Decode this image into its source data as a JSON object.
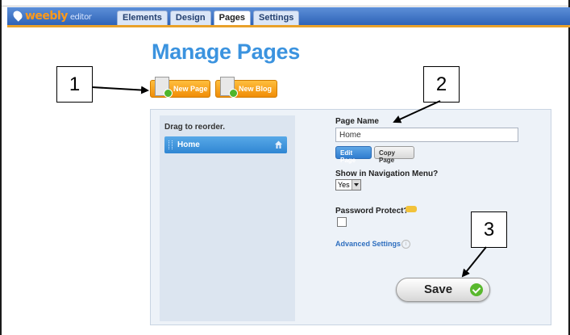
{
  "app": {
    "logo": "weebly",
    "logo_suffix": "editor",
    "tabs": [
      {
        "label": "Elements"
      },
      {
        "label": "Design"
      },
      {
        "label": "Pages",
        "active": true
      },
      {
        "label": "Settings"
      }
    ]
  },
  "page_title": "Manage Pages",
  "toolbar": {
    "new_page_label": "New Page",
    "new_blog_label": "New Blog"
  },
  "pages_list": {
    "instruction": "Drag to reorder.",
    "items": [
      {
        "label": "Home",
        "icon": "home-icon"
      }
    ]
  },
  "form": {
    "page_name_label": "Page Name",
    "page_name_value": "Home",
    "edit_page_label": "Edit Page",
    "copy_page_label": "Copy Page",
    "nav_menu_label": "Show in Navigation Menu?",
    "nav_menu_value": "Yes",
    "password_label": "Password Protect?",
    "password_checked": false,
    "advanced_label": "Advanced Settings",
    "save_label": "Save"
  },
  "callouts": [
    "1",
    "2",
    "3"
  ],
  "colors": {
    "accent_blue": "#3b93df",
    "orange": "#f08d07",
    "save_check": "#59b82d"
  }
}
